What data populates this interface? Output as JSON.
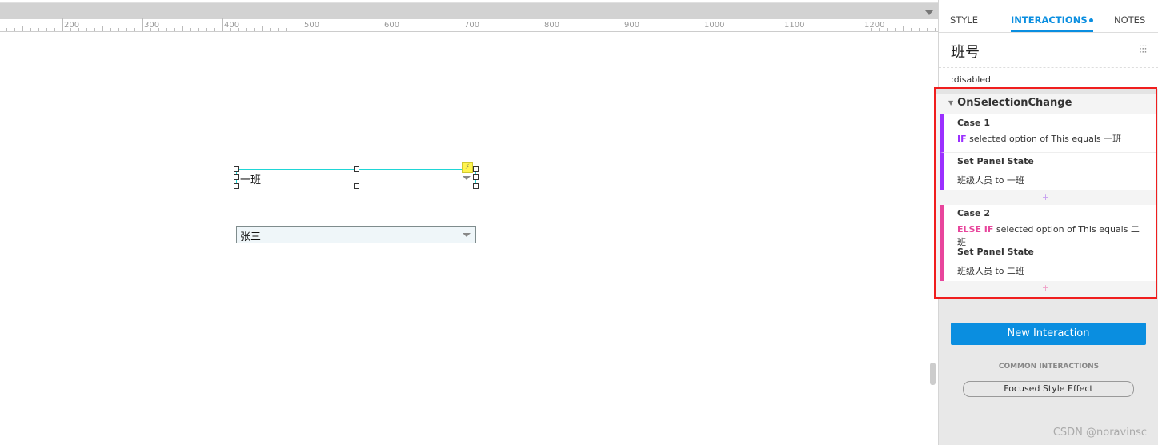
{
  "ruler": {
    "labels": [
      "200",
      "300",
      "400",
      "500",
      "600",
      "700",
      "800",
      "900",
      "1000",
      "1100",
      "1200"
    ]
  },
  "canvas": {
    "dropdown1": {
      "value": "一班"
    },
    "dropdown2": {
      "value": "张三"
    },
    "interaction_badge_icon": "lightning-icon"
  },
  "panel": {
    "tabs": [
      {
        "label": "STYLE"
      },
      {
        "label": "INTERACTIONS",
        "active": true
      },
      {
        "label": "NOTES"
      }
    ],
    "widget_name": "班号",
    "settings_icon": "sliders-icon",
    "state": ":disabled",
    "event": {
      "name": "OnSelectionChange",
      "cases": [
        {
          "title": "Case 1",
          "keyword": "IF",
          "condition": "selected option of This equals 一班",
          "color": "#9b30ff",
          "action": "Set Panel State",
          "action_detail": "班级人员 to 一班"
        },
        {
          "title": "Case 2",
          "keyword": "ELSE IF",
          "condition": "selected option of This equals 二班",
          "color": "#e8459c",
          "action": "Set Panel State",
          "action_detail": "班级人员 to 二班"
        }
      ],
      "add_label": "+"
    },
    "new_interaction": "New Interaction",
    "common_title": "COMMON INTERACTIONS",
    "common_items": [
      "Focused Style Effect"
    ],
    "accent": "#0a8ee0",
    "highlight_border": "#f01e1e"
  },
  "watermark": "CSDN @noravinsc"
}
